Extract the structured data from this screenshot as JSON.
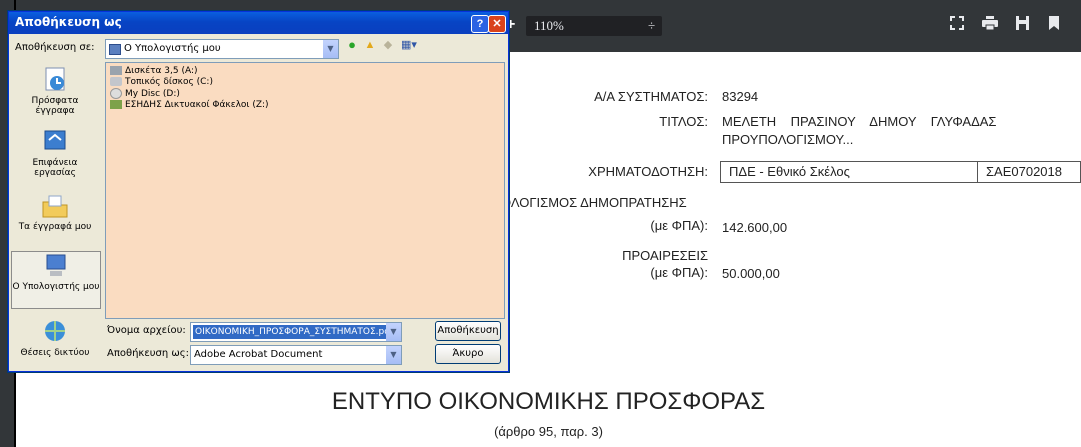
{
  "toolbar": {
    "zoom": "110%",
    "zoom_arrow": "÷",
    "plus": "+",
    "icons": [
      "fit-page-icon",
      "print-icon",
      "download-icon",
      "bookmark-icon"
    ]
  },
  "dialog": {
    "title": "Αποθήκευση ως",
    "help": "?",
    "close": "✕",
    "save_in_label": "Αποθήκευση σε:",
    "save_in_value": "Ο Υπολογιστής μου",
    "places": [
      {
        "label": "Πρόσφατα έγγραφα"
      },
      {
        "label": "Επιφάνεια εργασίας"
      },
      {
        "label": "Τα έγγραφά μου"
      },
      {
        "label": "Ο Υπολογιστής μου"
      },
      {
        "label": "Θέσεις δικτύου"
      }
    ],
    "files": [
      "Δισκέτα 3,5 (A:)",
      "Τοπικός δίσκος (C:)",
      "My Disc (D:)",
      "ΕΣΗΔΗΣ Δικτυακοί Φάκελοι (Z:)"
    ],
    "filename_label": "Όνομα αρχείου:",
    "filename_value": "ΟΙΚΟΝΟΜΙΚΗ_ΠΡΟΣΦΟΡΑ_ΣΥΣΤΗΜΑΤΟΣ.pdf",
    "savetype_label": "Αποθήκευση ως:",
    "savetype_value": "Adobe Acrobat Document",
    "save_button": "Αποθήκευση",
    "cancel_button": "Άκυρο"
  },
  "document": {
    "system_no_label": "Α/Α ΣΥΣΤΗΜΑΤΟΣ:",
    "system_no": "83294",
    "title_label": "ΤΙΤΛΟΣ:",
    "title_line1": "ΜΕΛΕΤΗ    ΠΡΑΣΙΝΟΥ    ΔΗΜΟΥ    ΓΛΥΦΑΔΑΣ",
    "title_line2": "ΠΡΟΥΠΟΛΟΓΙΣΜΟΥ...",
    "funding_label": "ΧΡΗΜΑΤΟΔΟΤΗΣΗ:",
    "funding_value": "ΠΔΕ - Εθνικό Σκέλος",
    "funding_code": "ΣΑΕ0702018",
    "budget_label": "ΟΛΟΓΙΣΜΟΣ ΔΗΜΟΠΡΑΤΗΣΗΣ",
    "budget_vat_label": "(με ΦΠΑ):",
    "budget_value": "142.600,00",
    "options_label": "ΠΡΟΑΙΡΕΣΕΙΣ",
    "options_vat_label": "(με ΦΠΑ):",
    "options_value": "50.000,00",
    "heading": "ΕΝΤΥΠΟ ΟΙΚΟΝΟΜΙΚΗΣ ΠΡΟΣΦΟΡΑΣ",
    "subheading": "(άρθρο 95, παρ. 3)"
  }
}
